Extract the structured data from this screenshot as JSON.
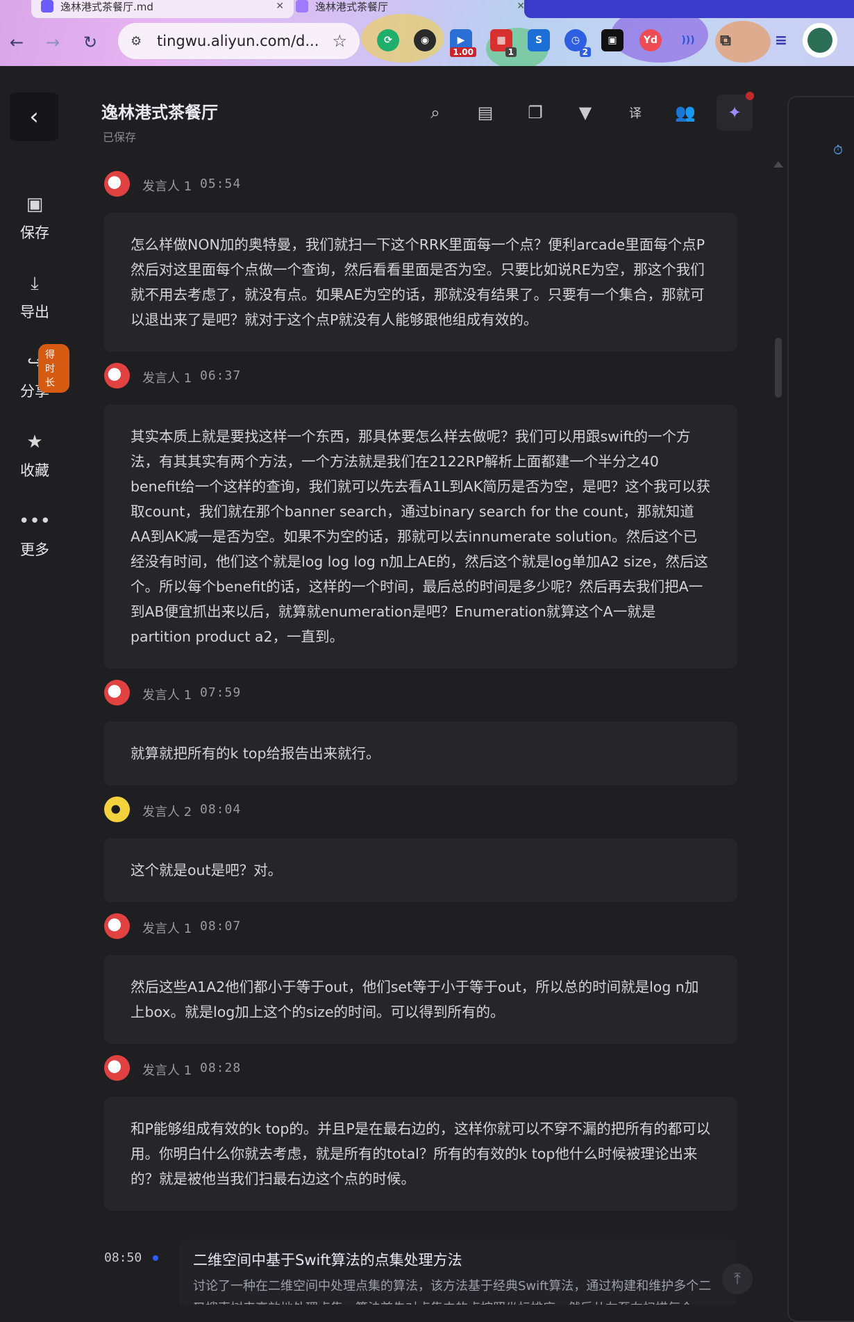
{
  "browser": {
    "tabs": [
      {
        "label": "逸林港式茶餐厅.md"
      },
      {
        "label": "逸林港式茶餐厅"
      }
    ],
    "url": "tingwu.aliyun.com/d...",
    "extensions": [
      {
        "name": "refresh-ext-icon"
      },
      {
        "name": "glasses-ext-icon"
      },
      {
        "name": "speed-ext-icon",
        "badge": "1.00"
      },
      {
        "name": "calendar-ext-icon",
        "badge": "1"
      },
      {
        "name": "s-ext-icon"
      },
      {
        "name": "clock-ext-icon",
        "badge": "2"
      },
      {
        "name": "video-ext-icon"
      },
      {
        "name": "yd-ext-icon",
        "text": "Yd"
      },
      {
        "name": "broadcast-ext-icon"
      },
      {
        "name": "puzzle-ext-icon"
      },
      {
        "name": "queue-ext-icon"
      }
    ]
  },
  "header": {
    "title": "逸林港式茶餐厅",
    "status": "已保存"
  },
  "rail": {
    "items": [
      {
        "label": "保存",
        "icon": "save-icon"
      },
      {
        "label": "导出",
        "icon": "export-icon"
      },
      {
        "label": "分享",
        "icon": "share-icon",
        "badge": "得时长"
      },
      {
        "label": "收藏",
        "icon": "star-icon"
      },
      {
        "label": "更多",
        "icon": "more-icon"
      }
    ]
  },
  "toolbar": [
    {
      "icon": "search-icon"
    },
    {
      "icon": "document-icon"
    },
    {
      "icon": "copy-icon"
    },
    {
      "icon": "filter-icon"
    },
    {
      "icon": "translate-icon",
      "text": "译"
    },
    {
      "icon": "users-icon"
    },
    {
      "icon": "magic-wand-icon"
    }
  ],
  "transcript": [
    {
      "speaker": "发言人 1",
      "time": "05:54",
      "text": "怎么样做NON加的奥特曼，我们就扫一下这个RRK里面每一个点？便利arcade里面每个点P然后对这里面每个点做一个查询，然后看看里面是否为空。只要比如说RE为空，那这个我们就不用去考虑了，就没有点。如果AE为空的话，那就没有结果了。只要有一个集合，那就可以退出来了是吧？就对于这个点P就没有人能够跟他组成有效的。"
    },
    {
      "speaker": "发言人 1",
      "time": "06:37",
      "text": "其实本质上就是要找这样一个东西，那具体要怎么样去做呢？我们可以用跟swift的一个方法，有其其实有两个方法，一个方法就是我们在2122RP解析上面都建一个半分之40 benefit给一个这样的查询，我们就可以先去看A1L到AK简历是否为空，是吧？这个我可以获取count，我们就在那个banner search，通过binary search for the count，那就知道AA到AK减一是否为空。如果不为空的话，那就可以去innumerate solution。然后这个已经没有时间，他们这个就是log log log n加上AE的，然后这个就是log单加A2 size，然后这个。所以每个benefit的话，这样的一个时间，最后总的时间是多少呢？然后再去我们把A一到AB便宜抓出来以后，就算就enumeration是吧？Enumeration就算这个A一就是partition product a2，一直到。"
    },
    {
      "speaker": "发言人 1",
      "time": "07:59",
      "text": "就算就把所有的k top给报告出来就行。"
    },
    {
      "speaker": "发言人 2",
      "time": "08:04",
      "text": "这个就是out是吧？对。"
    },
    {
      "speaker": "发言人 1",
      "time": "08:07",
      "text": "然后这些A1A2他们都小于等于out，他们set等于小于等于out，所以总的时间就是log n加上box。就是log加上这个的size的时间。可以得到所有的。"
    },
    {
      "speaker": "发言人 1",
      "time": "08:28",
      "text": "和P能够组成有效的k top的。并且P是在最右边的，这样你就可以不穿不漏的把所有的都可以用。你明白什么你就去考虑，就是所有的total？所有的有效的k top他什么时候被理论出来的？就是被他当我们扫最右边这个点的时候。"
    }
  ],
  "chapter": {
    "time": "08:50",
    "title": "二维空间中基于Swift算法的点集处理方法",
    "desc": "讨论了一种在二维空间中处理点集的算法，该方法基于经典Swift算法，通过构建和维护多个二叉搜索树来高效地处理点集。算法首先对点集中的点按照坐标排序，然后从左至右扫描每个"
  }
}
